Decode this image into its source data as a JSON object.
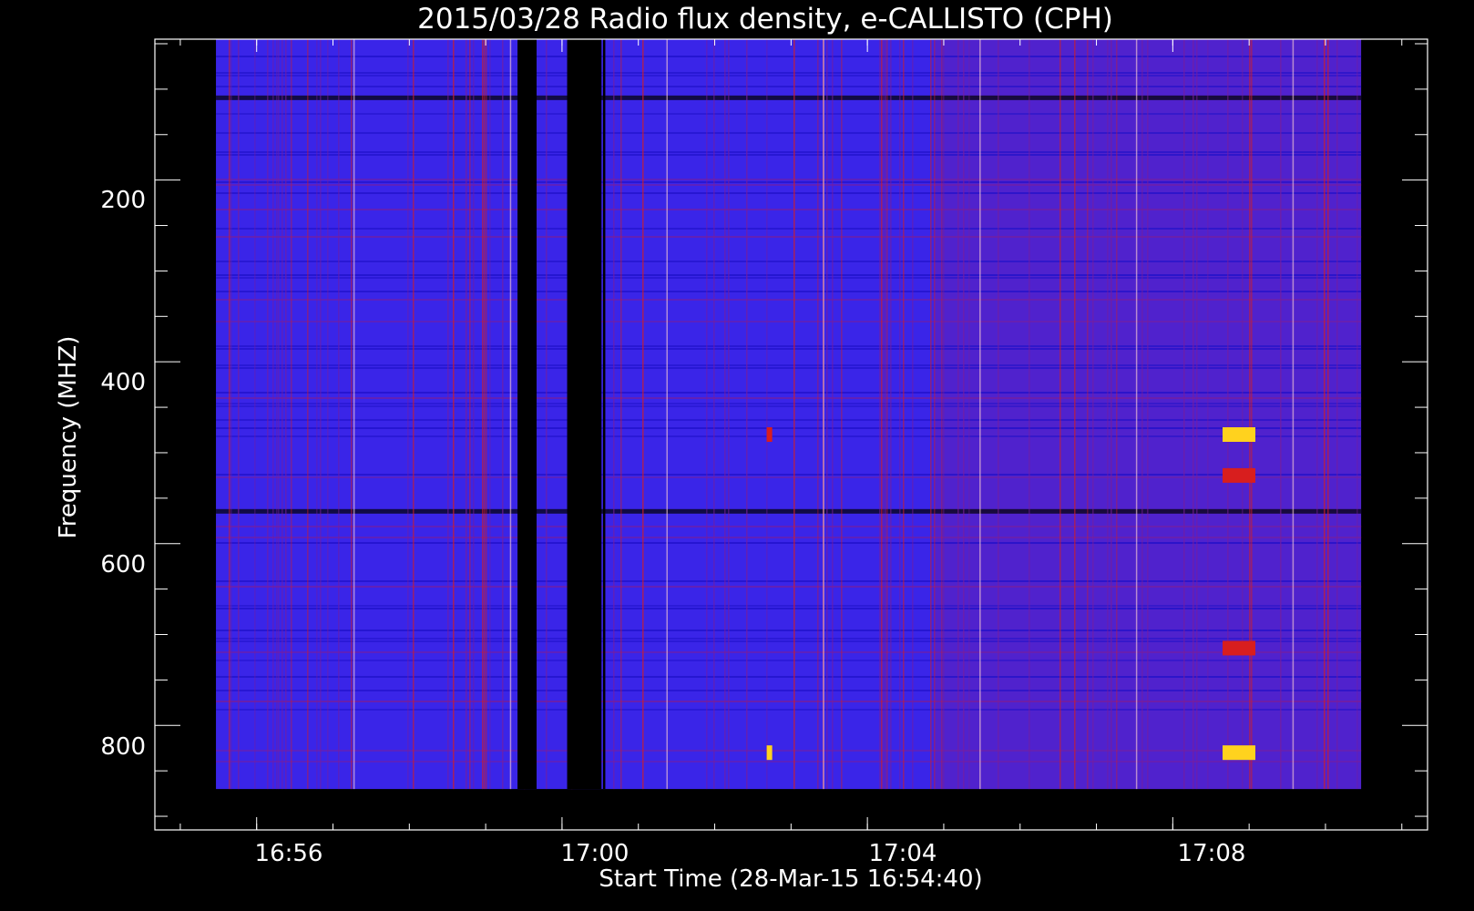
{
  "chart_data": {
    "type": "heatmap",
    "title": "2015/03/28  Radio flux density, e-CALLISTO (CPH)",
    "xlabel": "Start Time (28-Mar-15 16:54:40)",
    "ylabel": "Frequency (MHZ)",
    "x_ticks": [
      "16:56",
      "17:00",
      "17:04",
      "17:08"
    ],
    "x_tick_minutes": [
      1.333,
      5.333,
      9.333,
      13.333
    ],
    "y_ticks": [
      "200",
      "400",
      "600",
      "800"
    ],
    "y_tick_values": [
      200,
      400,
      600,
      800
    ],
    "xlim_minutes": [
      0,
      16.67
    ],
    "data_xlim_minutes": [
      0.8,
      15.8
    ],
    "ylim": [
      45,
      915
    ],
    "data_ylim": [
      45,
      870
    ],
    "colormap": {
      "background": "#3a25e8",
      "noise_low": "#1e10c8",
      "noise_high": "#7a1e9a",
      "hot": "#d81e1e",
      "hottest": "#ffd21e"
    },
    "data_gaps_minutes": [
      [
        4.75,
        5.0
      ],
      [
        5.4,
        5.85
      ],
      [
        5.87,
        5.9
      ]
    ],
    "bright_spots": [
      {
        "minute": 8.05,
        "mhz": 830,
        "intensity": "hottest"
      },
      {
        "minute": 8.05,
        "mhz": 480,
        "intensity": "hot"
      },
      {
        "minute": 14.2,
        "mhz": 830,
        "intensity": "hottest"
      },
      {
        "minute": 14.2,
        "mhz": 715,
        "intensity": "hot"
      },
      {
        "minute": 14.2,
        "mhz": 480,
        "intensity": "hottest"
      },
      {
        "minute": 14.2,
        "mhz": 525,
        "intensity": "hot"
      }
    ]
  }
}
